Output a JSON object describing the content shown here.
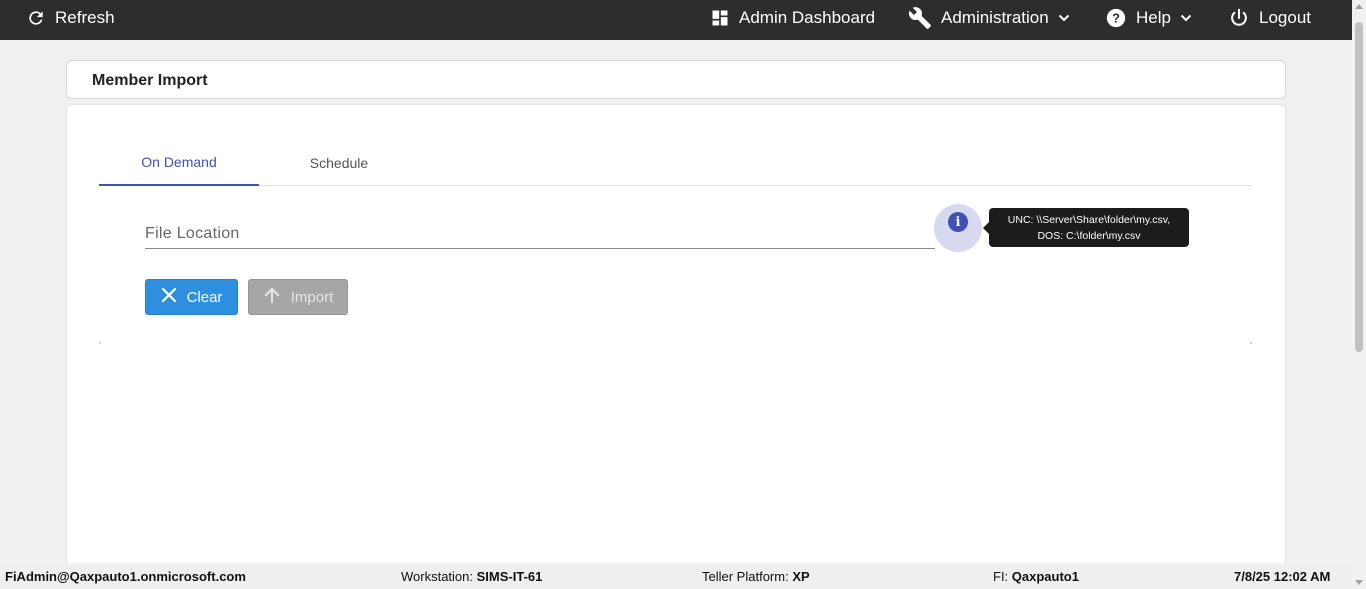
{
  "topbar": {
    "refresh_label": "Refresh",
    "dashboard_label": "Admin Dashboard",
    "administration_label": "Administration",
    "help_label": "Help",
    "logout_label": "Logout"
  },
  "page": {
    "title": "Member Import"
  },
  "tabs": [
    {
      "label": "On Demand",
      "active": true
    },
    {
      "label": "Schedule",
      "active": false
    }
  ],
  "form": {
    "file_location_placeholder": "File Location",
    "file_location_value": "",
    "info_glyph": "i",
    "tooltip_line1": "UNC: \\\\Server\\Share\\folder\\my.csv,",
    "tooltip_line2": "DOS: C:\\folder\\my.csv",
    "clear_label": "Clear",
    "import_label": "Import"
  },
  "status": {
    "user": "FiAdmin@Qaxpauto1.onmicrosoft.com",
    "workstation_label": "Workstation:",
    "workstation_value": "SIMS-IT-61",
    "teller_label": "Teller Platform:",
    "teller_value": "XP",
    "fi_label": "FI:",
    "fi_value": "Qaxpauto1",
    "datetime": "7/8/25 12:02 AM"
  },
  "colors": {
    "topbar": "#2d2d2d",
    "accent": "#3f51b5",
    "clear_button": "#2f8fdf",
    "import_button_disabled": "#a6a6a6",
    "tooltip": "#1c1c1c"
  },
  "icons": {
    "refresh": "refresh-icon",
    "dashboard": "dashboard-icon",
    "administration": "wrench-icon",
    "help": "help-icon",
    "logout": "power-icon",
    "info": "info-icon",
    "clear": "close-icon",
    "import": "arrow-up-icon"
  }
}
